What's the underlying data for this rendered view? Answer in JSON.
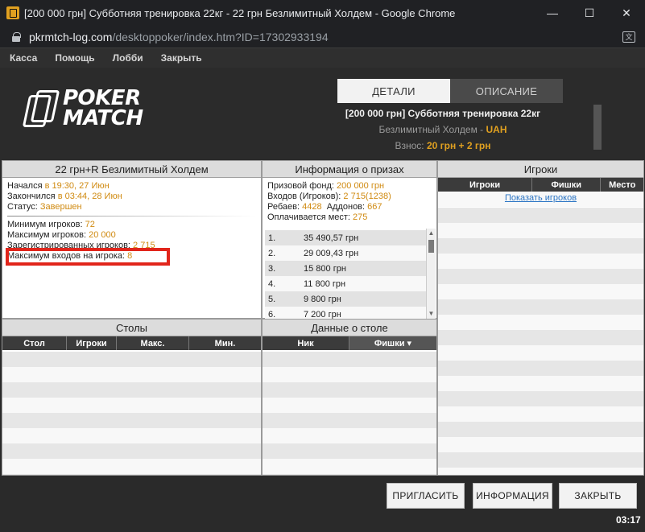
{
  "window": {
    "title": "[200 000 грн] Субботняя тренировка 22кг - 22 грн Безлимитный Холдем - Google Chrome",
    "minimize": "—",
    "maximize": "☐",
    "close": "✕"
  },
  "address": {
    "domain": "pkrmtch-log.com",
    "path": "/desktoppoker/index.htm?ID=17302933194",
    "translate_glyph": "文"
  },
  "menu": [
    "Касса",
    "Помощь",
    "Лобби",
    "Закрыть"
  ],
  "logo": {
    "line1": "POKER",
    "line2": "MATCH"
  },
  "tabs": {
    "details": "ДЕТАЛИ",
    "description": "ОПИСАНИЕ",
    "active": "details"
  },
  "tournament": {
    "title": "[200 000 грн] Субботняя тренировка 22кг",
    "game_label": "Безлимитный Холдем - ",
    "currency": "UAH",
    "buyin_label": "Взнос: ",
    "buyin_value": "20 грн + 2 грн"
  },
  "summary_panel": {
    "header": "22 грн+R Безлимитный Холдем",
    "started_label": "Начался ",
    "started_value": "в 19:30, 27 Июн",
    "ended_label": "Закончился ",
    "ended_value": "в 03:44, 28 Июн",
    "status_label": "Статус: ",
    "status_value": "Завершен",
    "min_players_label": "Минимум игроков: ",
    "min_players_value": "72",
    "max_players_label": "Максимум игроков: ",
    "max_players_value": "20 000",
    "registered_label": "Зарегистрированных игроков: ",
    "registered_value": "2 715",
    "max_entries_label": "Максимум входов на игрока: ",
    "max_entries_value": "8"
  },
  "prize_panel": {
    "header": "Информация о призах",
    "pool_label": "Призовой фонд: ",
    "pool_value": "200 000 грн",
    "entries_label": "Входов (Игроков): ",
    "entries_value": "2 715(1238)",
    "rebuys_label": "Ребаев: ",
    "rebuys_value": "4428",
    "addons_label": "Аддонов: ",
    "addons_value": "667",
    "paid_label": "Оплачивается мест: ",
    "paid_value": "275",
    "places": [
      {
        "place": "1.",
        "amount": "35 490,57 грн"
      },
      {
        "place": "2.",
        "amount": "29 009,43 грн"
      },
      {
        "place": "3.",
        "amount": "15 800 грн"
      },
      {
        "place": "4.",
        "amount": "11 800 грн"
      },
      {
        "place": "5.",
        "amount": "9 800 грн"
      },
      {
        "place": "6.",
        "amount": "7 200 грн"
      }
    ],
    "scroll_up": "▲",
    "scroll_down": "▼"
  },
  "players_panel": {
    "header": "Игроки",
    "columns": [
      "Игроки",
      "Фишки",
      "Место"
    ],
    "show_link": "Показать игроков"
  },
  "tables_panel": {
    "header": "Столы",
    "columns": [
      "Стол",
      "Игроки",
      "Макс.",
      "Мин."
    ]
  },
  "table_data_panel": {
    "header": "Данные о столе",
    "columns": [
      "Ник",
      "Фишки ▾"
    ]
  },
  "buttons": {
    "invite": "ПРИГЛАСИТЬ",
    "info": "ИНФОРМАЦИЯ",
    "close": "ЗАКРЫТЬ"
  },
  "clock": "03:17"
}
